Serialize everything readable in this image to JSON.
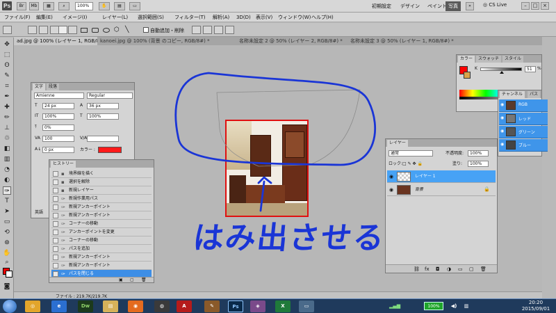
{
  "app": {
    "logo": "Ps",
    "zoom": "100%",
    "workspaces": [
      "初期設定",
      "デザイン",
      "ペイント",
      "写真"
    ],
    "active_workspace": "写真",
    "cslive": "CS Live"
  },
  "menus": [
    "ファイル(F)",
    "編集(E)",
    "イメージ(I)",
    "レイヤー(L)",
    "選択範囲(S)",
    "フィルター(T)",
    "解析(A)",
    "3D(D)",
    "表示(V)",
    "ウィンドウ(W)",
    "ヘルプ(H)"
  ],
  "options": {
    "auto_add_delete": "自動追加・削除"
  },
  "doc_tabs": [
    "ad.jpg @ 100% (レイヤー 1, RGB/8#) *",
    "kanoei.jpg @ 100% (背景 のコピー, RGB/8#) *",
    "名称未設定 2 @ 50% (レイヤー 2, RGB/8#) *",
    "名称未設定 3 @ 50% (レイヤー 1, RGB/8#) *"
  ],
  "character": {
    "tabs": [
      "文字",
      "段落"
    ],
    "font": "Amienne",
    "style": "Regular",
    "size": "24 px",
    "leading": "36 px",
    "vscale": "100%",
    "hscale": "100%",
    "baseline_shift": "0%",
    "tracking": "100",
    "kern": "0 px",
    "color_label": "カラー :",
    "lang": "英語"
  },
  "history": {
    "title": "ヒストリー",
    "items": [
      "境界線を描く",
      "選択を解除",
      "新規レイヤー",
      "新規作業用パス",
      "新規アンカーポイント",
      "新規アンカーポイント",
      "コーナーの移動",
      "アンカーポイントを変更",
      "コーナーの移動",
      "パスを追加",
      "新規アンカーポイント",
      "新規アンカーポイント",
      "パスを閉じる"
    ],
    "selected": "パスを閉じる"
  },
  "layers": {
    "title": "レイヤー",
    "blend": "通常",
    "opacity_label": "不透明度:",
    "opacity": "100%",
    "lock_label": "ロック:",
    "fill_label": "塗り:",
    "fill": "100%",
    "items": [
      {
        "name": "レイヤー 1",
        "selected": true
      },
      {
        "name": "背景",
        "selected": false
      }
    ]
  },
  "color": {
    "tabs": [
      "カラー",
      "スウォッチ",
      "スタイル"
    ],
    "k_label": "K",
    "k_value": "51",
    "k_unit": "%",
    "k_fraction": 0.51
  },
  "channels": {
    "tabs": [
      "チャンネル",
      "パス"
    ],
    "items": [
      "RGB",
      "レッド",
      "グリーン",
      "ブルー"
    ]
  },
  "status": {
    "file": "ファイル : 219.7K/219.7K"
  },
  "annotation": {
    "text": "はみ出させる"
  },
  "taskbar": {
    "battery": "100%",
    "time": "20:20",
    "date": "2015/09/01"
  },
  "colors": {
    "annotation_blue": "#1a35d6",
    "photo_border": "#e01010",
    "selection": "#3d8ee6",
    "foreground_swatch": "#ff0000"
  }
}
